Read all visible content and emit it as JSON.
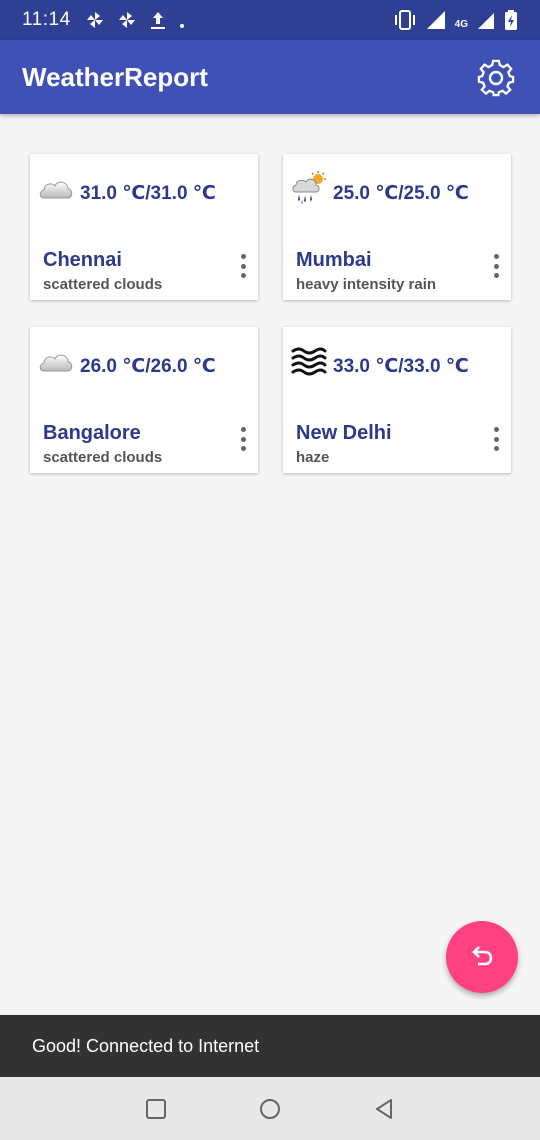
{
  "status_bar": {
    "time": "11:14",
    "network": "4G",
    "icons": [
      "pinwheel-icon",
      "pinwheel-icon",
      "upload-icon",
      "dot-icon",
      "vibrate-icon",
      "signal-icon",
      "battery-icon"
    ]
  },
  "app_bar": {
    "title": "WeatherReport",
    "settings_icon": "gear-icon"
  },
  "cards": [
    {
      "temp": "31.0 ℃/31.0 ℃",
      "city": "Chennai",
      "desc": "scattered clouds",
      "icon": "cloud-icon"
    },
    {
      "temp": "25.0 ℃/25.0 ℃",
      "city": "Mumbai",
      "desc": "heavy intensity rain",
      "icon": "rain-sun-icon"
    },
    {
      "temp": "26.0 ℃/26.0 ℃",
      "city": "Bangalore",
      "desc": "scattered clouds",
      "icon": "cloud-icon"
    },
    {
      "temp": "33.0 ℃/33.0 ℃",
      "city": "New Delhi",
      "desc": "haze",
      "icon": "haze-icon"
    }
  ],
  "fab": {
    "icon": "undo-icon"
  },
  "snackbar": {
    "message": "Good! Connected to Internet"
  },
  "nav": {
    "buttons": [
      "recents-icon",
      "home-icon",
      "back-icon"
    ]
  },
  "colors": {
    "status_bar": "#2e3f94",
    "app_bar": "#3f51b5",
    "accent": "#ff4081",
    "text_primary": "#2c3a8c"
  }
}
